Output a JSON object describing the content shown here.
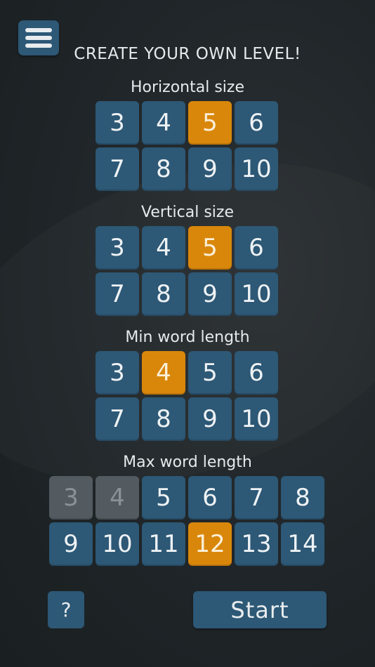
{
  "title": "CREATE YOUR OWN LEVEL!",
  "menu": {
    "icon": "hamburger-menu-icon"
  },
  "horizontal_size": {
    "label": "Horizontal size",
    "options": [
      "3",
      "4",
      "5",
      "6",
      "7",
      "8",
      "9",
      "10"
    ],
    "selected": "5",
    "disabled": []
  },
  "vertical_size": {
    "label": "Vertical size",
    "options": [
      "3",
      "4",
      "5",
      "6",
      "7",
      "8",
      "9",
      "10"
    ],
    "selected": "5",
    "disabled": []
  },
  "min_word_length": {
    "label": "Min word length",
    "options": [
      "3",
      "4",
      "5",
      "6",
      "7",
      "8",
      "9",
      "10"
    ],
    "selected": "4",
    "disabled": []
  },
  "max_word_length": {
    "label": "Max word length",
    "options": [
      "3",
      "4",
      "5",
      "6",
      "7",
      "8",
      "9",
      "10",
      "11",
      "12",
      "13",
      "14"
    ],
    "selected": "12",
    "disabled": [
      "3",
      "4"
    ]
  },
  "help_label": "?",
  "start_label": "Start",
  "colors": {
    "tile": "#2d5876",
    "selected": "#d9870b",
    "disabled": "#545b60"
  }
}
